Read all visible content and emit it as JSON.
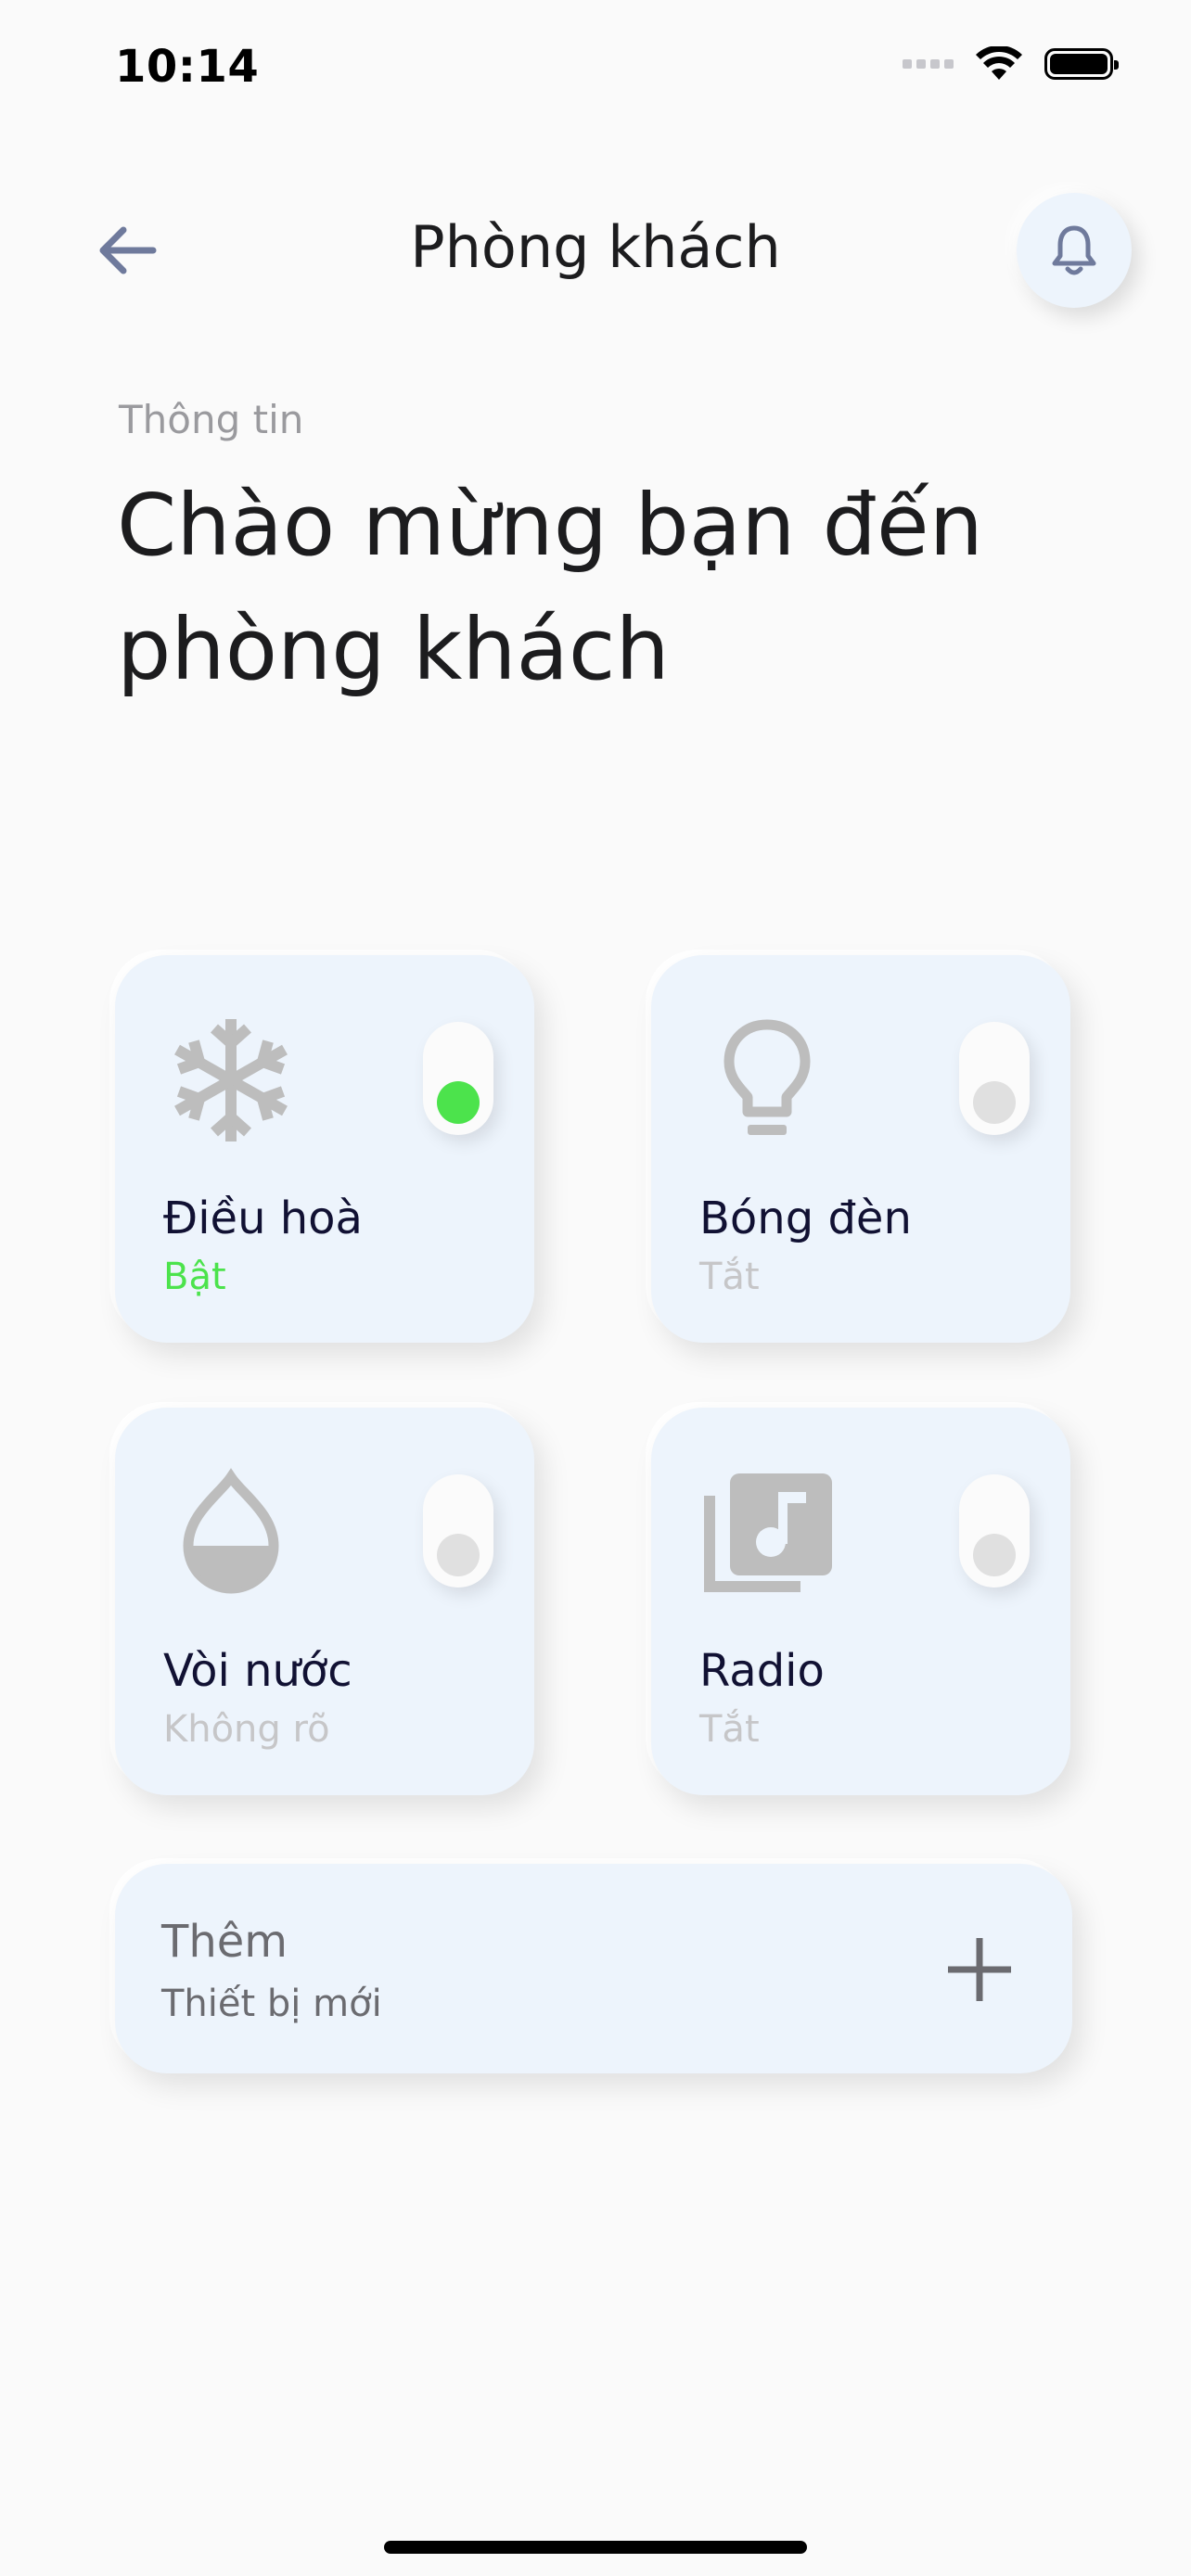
{
  "status_bar": {
    "time": "10:14"
  },
  "header": {
    "title": "Phòng khách",
    "back_icon": "arrow-left-icon",
    "bell_icon": "bell-icon"
  },
  "info": {
    "label": "Thông tin",
    "headline": "Chào mừng bạn đến phòng khách"
  },
  "devices": [
    {
      "name": "Điều hoà",
      "status": "Bật",
      "on": true,
      "icon": "snowflake-icon"
    },
    {
      "name": "Bóng đèn",
      "status": "Tắt",
      "on": false,
      "icon": "lightbulb-icon"
    },
    {
      "name": "Vòi nước",
      "status": "Không rõ",
      "on": false,
      "icon": "water-drop-icon"
    },
    {
      "name": "Radio",
      "status": "Tắt",
      "on": false,
      "icon": "music-library-icon"
    }
  ],
  "add_device": {
    "title": "Thêm",
    "subtitle": "Thiết bị mới",
    "icon": "plus-icon"
  },
  "colors": {
    "accent_on": "#4ce34c",
    "card_bg": "#edf4fc",
    "icon_gray": "#bdbdbd"
  }
}
